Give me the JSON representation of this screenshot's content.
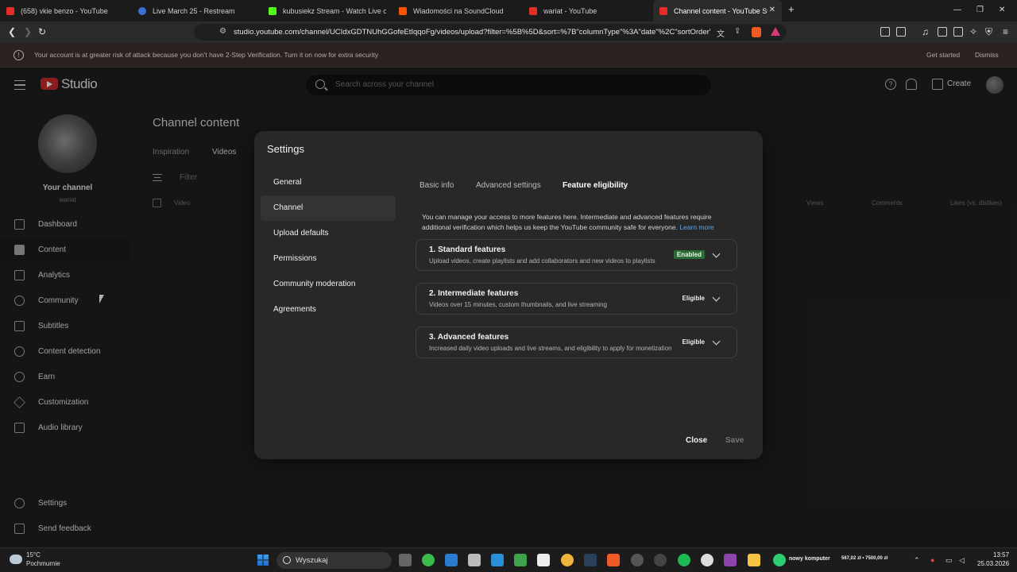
{
  "browser": {
    "tabs": [
      {
        "title": "(658) vkie benzo - YouTube",
        "favicon_color": "#e52d27"
      },
      {
        "title": "Live March 25 - Restream",
        "favicon_color": "#3a6fd8"
      },
      {
        "title": "kubusiekz Stream - Watch Live on Ki",
        "favicon_color": "#53fc18"
      },
      {
        "title": "Wiadomości na SoundCloud",
        "favicon_color": "#ff5500"
      },
      {
        "title": "wariat - YouTube",
        "favicon_color": "#e52d27"
      },
      {
        "title": "Channel content - YouTube Studi",
        "favicon_color": "#e52d27",
        "active": true
      }
    ],
    "new_tab": "+",
    "url": "studio.youtube.com/channel/UCIdxGDTNUhGGofeEtIqqoFg/videos/upload?filter=%5B%5D&sort=%7B\"columnType\"%3A\"date\"%2C\"sortOrder\"..."
  },
  "warning_banner": {
    "text": "Your account is at greater risk of attack because you don't have 2-Step Verification. Turn it on now for extra security",
    "get_started": "Get started",
    "dismiss": "Dismiss"
  },
  "header": {
    "logo_text": "Studio",
    "search_placeholder": "Search across your channel",
    "help": "?",
    "create": "Create"
  },
  "sidebar": {
    "your_channel": "Your channel",
    "handle": "wariat",
    "items": [
      {
        "label": "Dashboard",
        "icon": "dashboard-icon"
      },
      {
        "label": "Content",
        "icon": "content-icon",
        "active": true
      },
      {
        "label": "Analytics",
        "icon": "analytics-icon"
      },
      {
        "label": "Community",
        "icon": "community-icon"
      },
      {
        "label": "Subtitles",
        "icon": "subtitles-icon"
      },
      {
        "label": "Content detection",
        "icon": "content-detection-icon"
      },
      {
        "label": "Earn",
        "icon": "earn-icon"
      },
      {
        "label": "Customization",
        "icon": "customization-icon"
      },
      {
        "label": "Audio library",
        "icon": "audio-library-icon"
      }
    ],
    "bottom": [
      {
        "label": "Settings",
        "icon": "gear-icon"
      },
      {
        "label": "Send feedback",
        "icon": "feedback-icon"
      }
    ]
  },
  "page": {
    "title": "Channel content",
    "tabs": [
      "Inspiration",
      "Videos"
    ],
    "filter_label": "Filter",
    "columns": [
      "Video",
      "Views",
      "Comments",
      "Likes (vs. dislikes)"
    ]
  },
  "settings": {
    "title": "Settings",
    "nav": [
      "General",
      "Channel",
      "Upload defaults",
      "Permissions",
      "Community moderation",
      "Agreements"
    ],
    "active_nav": "Channel",
    "subtabs": [
      "Basic info",
      "Advanced settings",
      "Feature eligibility"
    ],
    "active_subtab": "Feature eligibility",
    "intro": "You can manage your access to more features here. Intermediate and advanced features require additional verification which helps us keep the YouTube community safe for everyone.",
    "learn_more": "Learn more",
    "features": [
      {
        "title": "1. Standard features",
        "desc": "Upload videos, create playlists and add collaborators and new videos to playlists",
        "status": "Enabled"
      },
      {
        "title": "2. Intermediate features",
        "desc": "Videos over 15 minutes, custom thumbnails, and live streaming",
        "status": "Eligible"
      },
      {
        "title": "3. Advanced features",
        "desc": "Increased daily video uploads and live streams, and eligibility to apply for monetization",
        "status": "Eligible"
      }
    ],
    "close": "Close",
    "save": "Save"
  },
  "taskbar": {
    "temperature": "15°C",
    "weather": "Pochmurnie",
    "search": "Wyszukaj",
    "app_label": "nowy komputer",
    "app_label_2": "567,02 zł • 7500,00 zł",
    "time": "13:57",
    "date": "25.03.2026"
  }
}
